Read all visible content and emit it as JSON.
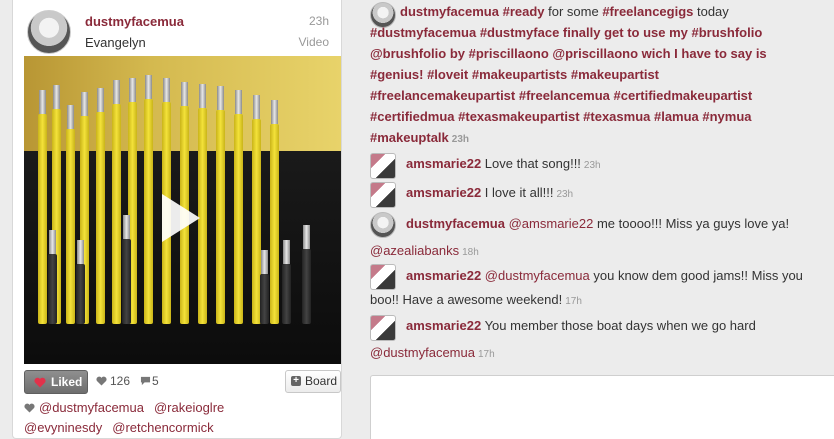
{
  "post": {
    "username": "dustmyfacemua",
    "full_name": "Evangelyn",
    "time": "23h",
    "media_type": "Video",
    "liked_label": "Liked",
    "likes_count": "126",
    "comments_count": "5",
    "board_label": "Board",
    "likers": [
      "@dustmyfacemua",
      "@rakeioglre",
      "@evyninesdy",
      "@retchencormick"
    ]
  },
  "caption": {
    "username": "dustmyfacemua",
    "segments": [
      {
        "kind": "tag",
        "text": "#ready"
      },
      {
        "kind": "plain",
        "text": " for some "
      },
      {
        "kind": "tag",
        "text": "#freelancegigs"
      },
      {
        "kind": "plain",
        "text": " today"
      }
    ],
    "line2": "#dustmyfacemua #dustmyface finally get to use my #brushfolio @brushfolio by #priscillaono @priscillaono wich I have to say is #genius! #loveit #makeupartists #makeupartist #freelancemakeupartist #freelancemua #certifiedmakeupartist #certifiedmua #texasmakeupartist #texasmua #lamua #nymua #makeuptalk",
    "time": "23h"
  },
  "comments": [
    {
      "user": "amsmarie22",
      "text": "Love that song!!!",
      "time": "23h"
    },
    {
      "user": "amsmarie22",
      "text": "I love it all!!!",
      "time": "23h"
    },
    {
      "user": "dustmyfacemua",
      "mention": "@amsmarie22",
      "text": " me toooo!!! Miss ya guys love ya!",
      "mention2": "@azealiabanks",
      "time": "18h"
    },
    {
      "user": "amsmarie22",
      "mention": "@dustmyfacemua",
      "text": " you know dem good jams!! Miss you boo!! Have a awesome weekend!",
      "time": "17h"
    },
    {
      "user": "amsmarie22",
      "text": "You member those boat days when we go hard",
      "mention2": "@dustmyfacemua",
      "time": "17h"
    }
  ],
  "colors": {
    "accent": "#8a2a3a",
    "muted": "#999999",
    "background": "#ececec"
  },
  "icons": {
    "heart": "heart-icon",
    "comment": "comment-icon",
    "plus": "plus-icon",
    "play": "play-icon"
  }
}
